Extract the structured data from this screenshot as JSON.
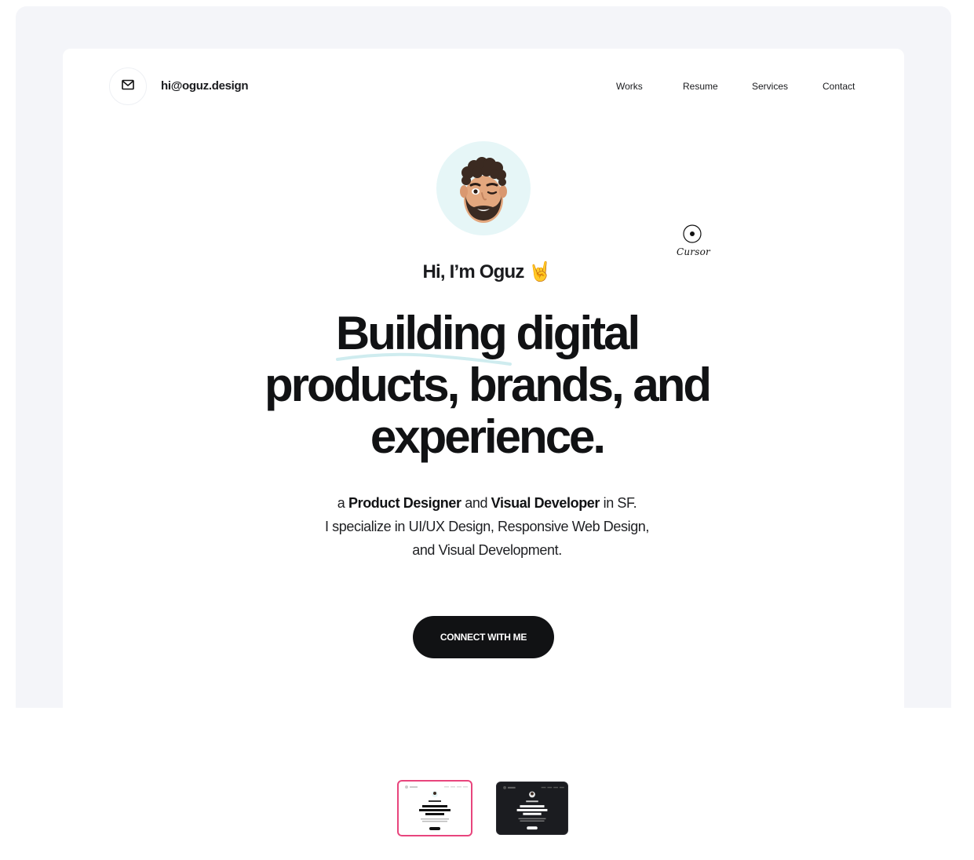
{
  "header": {
    "email": "hi@oguz.design",
    "nav": [
      "Works",
      "Resume",
      "Services",
      "Contact"
    ]
  },
  "hero": {
    "greeting": "Hi, I’m Oguz 🤘",
    "headline": [
      "Building digital",
      "products, brands, and",
      "experience."
    ],
    "intro": {
      "prefix": "a ",
      "role1": "Product Designer",
      "mid": " and ",
      "role2": "Visual Developer",
      "suffix": " in SF.",
      "line2": "I specialize in UI/UX Design, Responsive Web Design,",
      "line3": "and Visual Development."
    },
    "cta_label": "CONNECT WITH ME"
  },
  "cursor_label": "Cursor",
  "theme_thumbnails": [
    {
      "theme": "light",
      "selected": true
    },
    {
      "theme": "dark",
      "selected": false
    }
  ],
  "colors": {
    "accent_underline": "#cfecef",
    "avatar_bg": "#e6f6f7",
    "cta_bg": "#111214",
    "selected_border": "#e8457d"
  }
}
